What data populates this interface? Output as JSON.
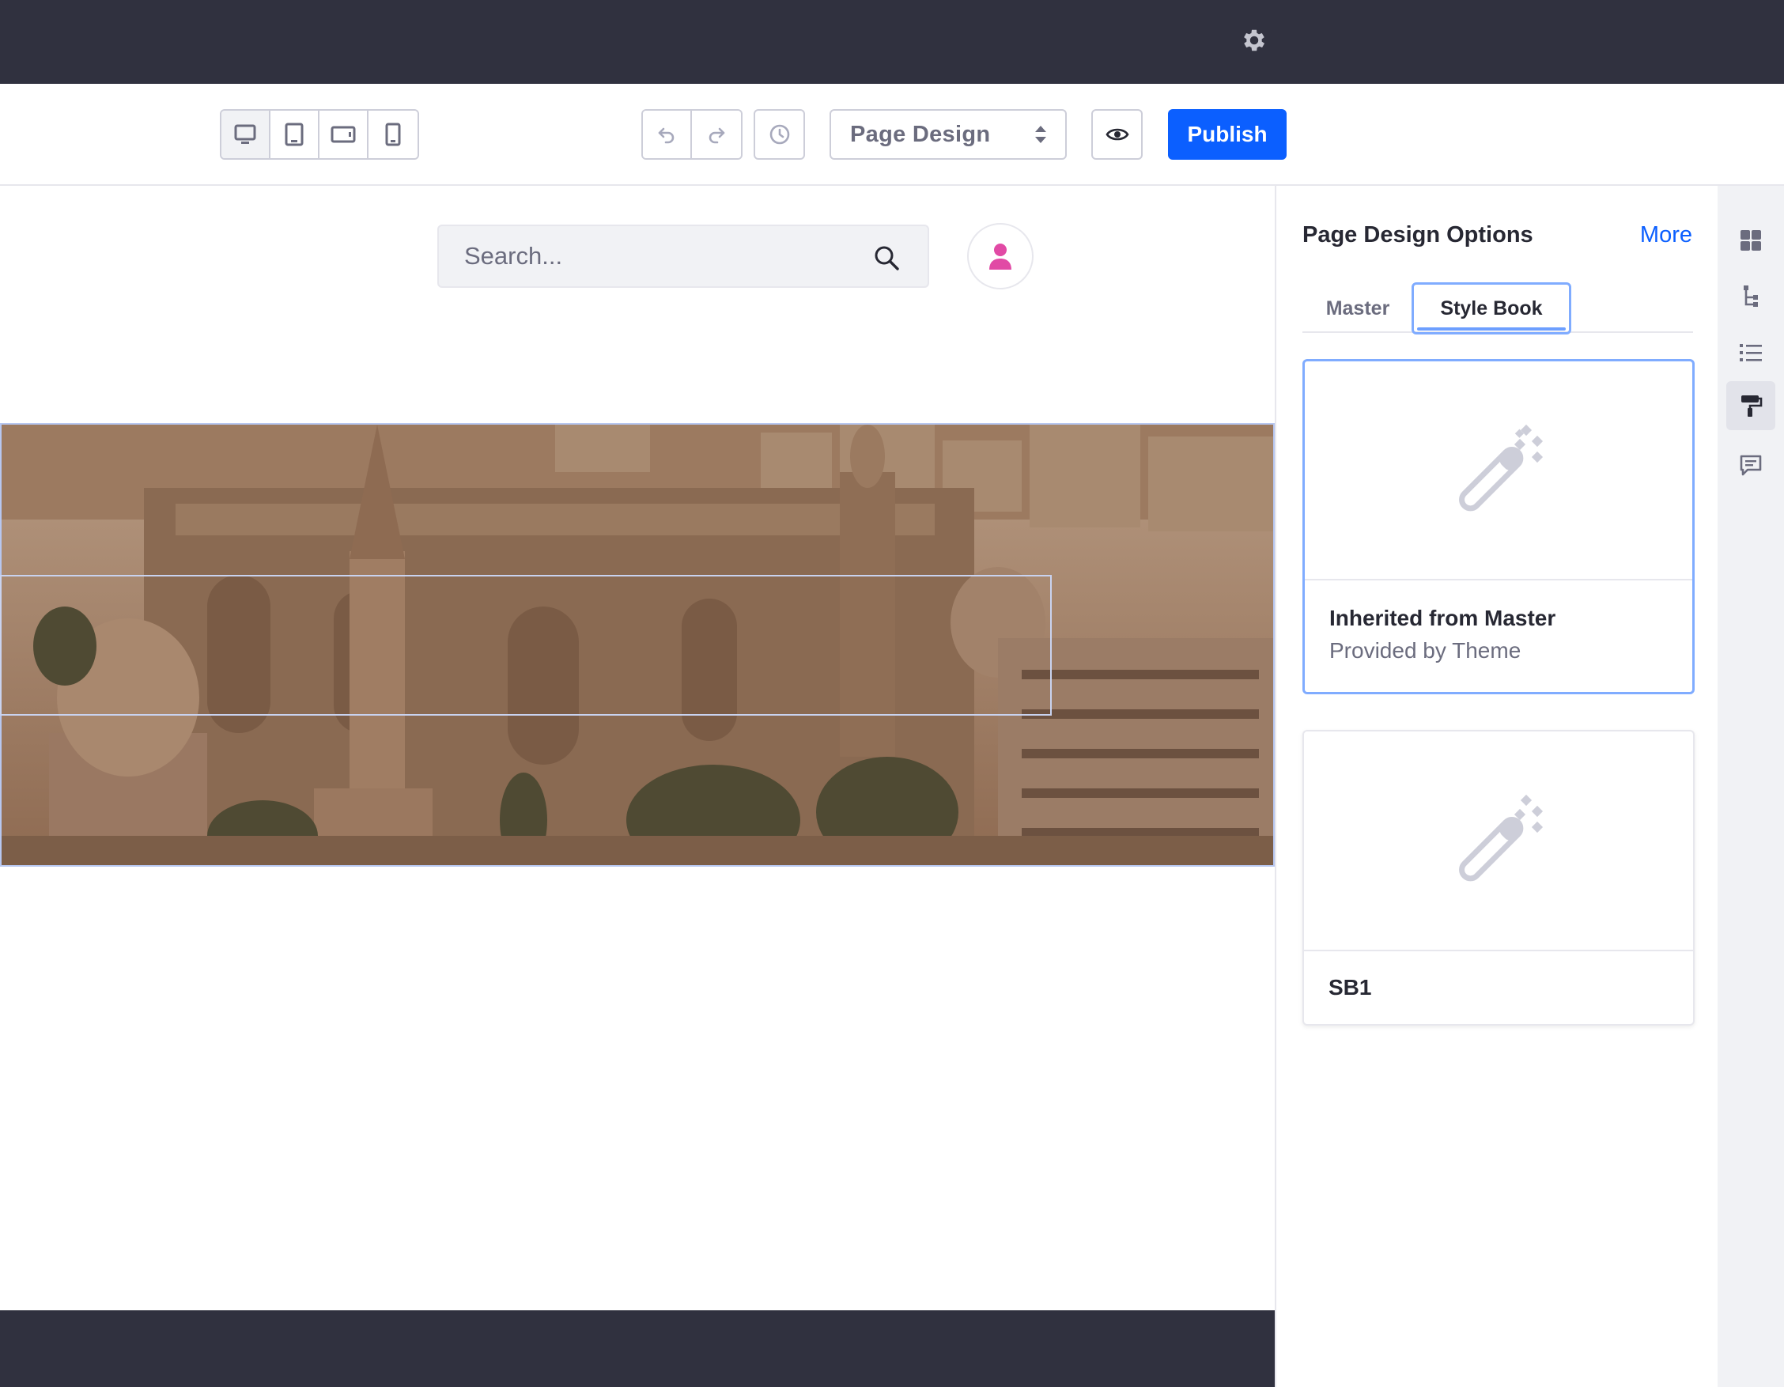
{
  "topbar": {
    "settings_icon": "gear-icon"
  },
  "toolbar": {
    "viewports": [
      {
        "name": "desktop",
        "icon": "desktop-icon",
        "active": true
      },
      {
        "name": "tablet",
        "icon": "tablet-icon",
        "active": false
      },
      {
        "name": "landscape-phone",
        "icon": "landscape-phone-icon",
        "active": false
      },
      {
        "name": "portrait-phone",
        "icon": "portrait-phone-icon",
        "active": false
      }
    ],
    "undo_icon": "undo-icon",
    "redo_icon": "redo-icon",
    "history_icon": "history-icon",
    "mode_select": {
      "selected": "Page Design",
      "icon": "caret-double-icon"
    },
    "preview_icon": "eye-icon",
    "publish_label": "Publish"
  },
  "canvas": {
    "search": {
      "placeholder": "Search..."
    },
    "avatar_icon": "user-icon",
    "banner_image": "cityscape-mosque-photo"
  },
  "panel": {
    "title": "Page Design Options",
    "more_label": "More",
    "tabs": [
      {
        "label": "Master",
        "active": false
      },
      {
        "label": "Style Book",
        "active": true
      }
    ],
    "cards": [
      {
        "title": "Inherited from Master",
        "subtitle": "Provided by Theme",
        "selected": true,
        "icon": "magic-wand-icon"
      },
      {
        "title": "SB1",
        "subtitle": "",
        "selected": false,
        "icon": "magic-wand-icon"
      }
    ]
  },
  "rail": {
    "items": [
      {
        "icon": "fragments-grid-icon",
        "active": false
      },
      {
        "icon": "page-structure-icon",
        "active": false
      },
      {
        "icon": "list-icon",
        "active": false
      },
      {
        "icon": "paint-roller-icon",
        "active": true
      },
      {
        "icon": "comments-icon",
        "active": false
      }
    ]
  },
  "colors": {
    "dark_bar": "#30313f",
    "primary": "#0b5fff",
    "selected_border": "#80acff",
    "muted_text": "#6b6c7e",
    "avatar_pink": "#e14aa5"
  }
}
